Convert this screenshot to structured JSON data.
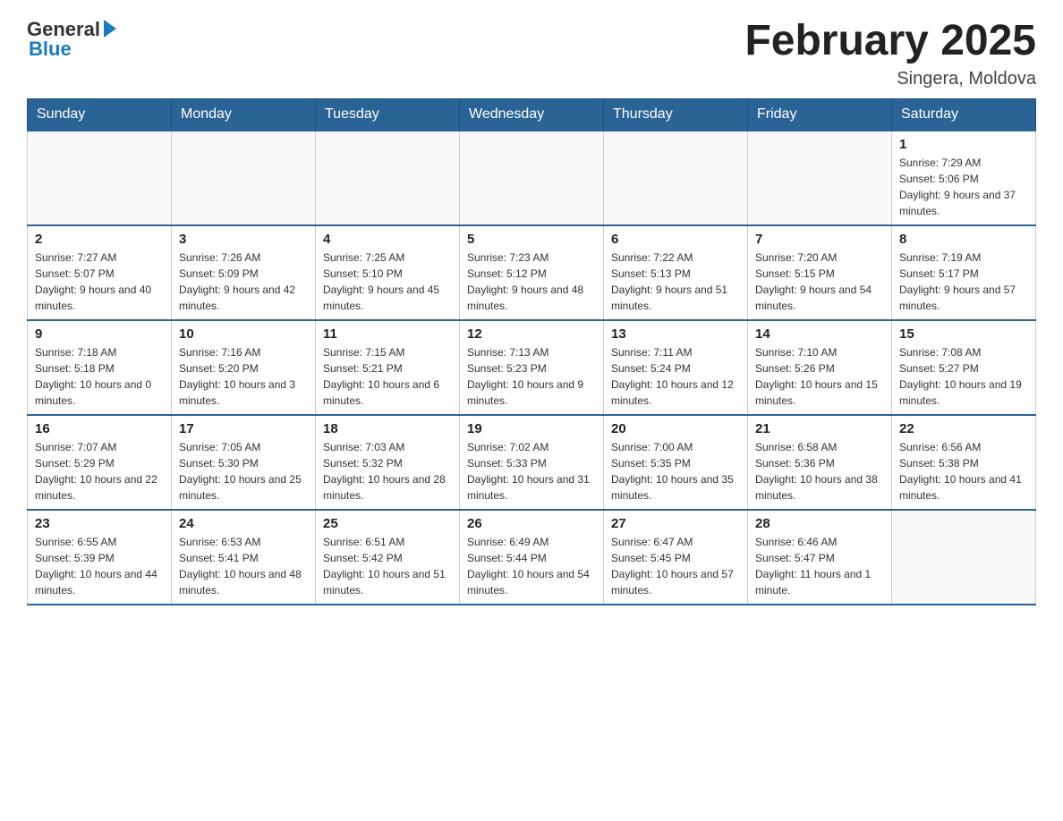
{
  "header": {
    "logo": {
      "general": "General",
      "blue": "Blue"
    },
    "title": "February 2025",
    "location": "Singera, Moldova"
  },
  "weekdays": [
    "Sunday",
    "Monday",
    "Tuesday",
    "Wednesday",
    "Thursday",
    "Friday",
    "Saturday"
  ],
  "weeks": [
    [
      {
        "day": "",
        "info": ""
      },
      {
        "day": "",
        "info": ""
      },
      {
        "day": "",
        "info": ""
      },
      {
        "day": "",
        "info": ""
      },
      {
        "day": "",
        "info": ""
      },
      {
        "day": "",
        "info": ""
      },
      {
        "day": "1",
        "info": "Sunrise: 7:29 AM\nSunset: 5:06 PM\nDaylight: 9 hours and 37 minutes."
      }
    ],
    [
      {
        "day": "2",
        "info": "Sunrise: 7:27 AM\nSunset: 5:07 PM\nDaylight: 9 hours and 40 minutes."
      },
      {
        "day": "3",
        "info": "Sunrise: 7:26 AM\nSunset: 5:09 PM\nDaylight: 9 hours and 42 minutes."
      },
      {
        "day": "4",
        "info": "Sunrise: 7:25 AM\nSunset: 5:10 PM\nDaylight: 9 hours and 45 minutes."
      },
      {
        "day": "5",
        "info": "Sunrise: 7:23 AM\nSunset: 5:12 PM\nDaylight: 9 hours and 48 minutes."
      },
      {
        "day": "6",
        "info": "Sunrise: 7:22 AM\nSunset: 5:13 PM\nDaylight: 9 hours and 51 minutes."
      },
      {
        "day": "7",
        "info": "Sunrise: 7:20 AM\nSunset: 5:15 PM\nDaylight: 9 hours and 54 minutes."
      },
      {
        "day": "8",
        "info": "Sunrise: 7:19 AM\nSunset: 5:17 PM\nDaylight: 9 hours and 57 minutes."
      }
    ],
    [
      {
        "day": "9",
        "info": "Sunrise: 7:18 AM\nSunset: 5:18 PM\nDaylight: 10 hours and 0 minutes."
      },
      {
        "day": "10",
        "info": "Sunrise: 7:16 AM\nSunset: 5:20 PM\nDaylight: 10 hours and 3 minutes."
      },
      {
        "day": "11",
        "info": "Sunrise: 7:15 AM\nSunset: 5:21 PM\nDaylight: 10 hours and 6 minutes."
      },
      {
        "day": "12",
        "info": "Sunrise: 7:13 AM\nSunset: 5:23 PM\nDaylight: 10 hours and 9 minutes."
      },
      {
        "day": "13",
        "info": "Sunrise: 7:11 AM\nSunset: 5:24 PM\nDaylight: 10 hours and 12 minutes."
      },
      {
        "day": "14",
        "info": "Sunrise: 7:10 AM\nSunset: 5:26 PM\nDaylight: 10 hours and 15 minutes."
      },
      {
        "day": "15",
        "info": "Sunrise: 7:08 AM\nSunset: 5:27 PM\nDaylight: 10 hours and 19 minutes."
      }
    ],
    [
      {
        "day": "16",
        "info": "Sunrise: 7:07 AM\nSunset: 5:29 PM\nDaylight: 10 hours and 22 minutes."
      },
      {
        "day": "17",
        "info": "Sunrise: 7:05 AM\nSunset: 5:30 PM\nDaylight: 10 hours and 25 minutes."
      },
      {
        "day": "18",
        "info": "Sunrise: 7:03 AM\nSunset: 5:32 PM\nDaylight: 10 hours and 28 minutes."
      },
      {
        "day": "19",
        "info": "Sunrise: 7:02 AM\nSunset: 5:33 PM\nDaylight: 10 hours and 31 minutes."
      },
      {
        "day": "20",
        "info": "Sunrise: 7:00 AM\nSunset: 5:35 PM\nDaylight: 10 hours and 35 minutes."
      },
      {
        "day": "21",
        "info": "Sunrise: 6:58 AM\nSunset: 5:36 PM\nDaylight: 10 hours and 38 minutes."
      },
      {
        "day": "22",
        "info": "Sunrise: 6:56 AM\nSunset: 5:38 PM\nDaylight: 10 hours and 41 minutes."
      }
    ],
    [
      {
        "day": "23",
        "info": "Sunrise: 6:55 AM\nSunset: 5:39 PM\nDaylight: 10 hours and 44 minutes."
      },
      {
        "day": "24",
        "info": "Sunrise: 6:53 AM\nSunset: 5:41 PM\nDaylight: 10 hours and 48 minutes."
      },
      {
        "day": "25",
        "info": "Sunrise: 6:51 AM\nSunset: 5:42 PM\nDaylight: 10 hours and 51 minutes."
      },
      {
        "day": "26",
        "info": "Sunrise: 6:49 AM\nSunset: 5:44 PM\nDaylight: 10 hours and 54 minutes."
      },
      {
        "day": "27",
        "info": "Sunrise: 6:47 AM\nSunset: 5:45 PM\nDaylight: 10 hours and 57 minutes."
      },
      {
        "day": "28",
        "info": "Sunrise: 6:46 AM\nSunset: 5:47 PM\nDaylight: 11 hours and 1 minute."
      },
      {
        "day": "",
        "info": ""
      }
    ]
  ]
}
